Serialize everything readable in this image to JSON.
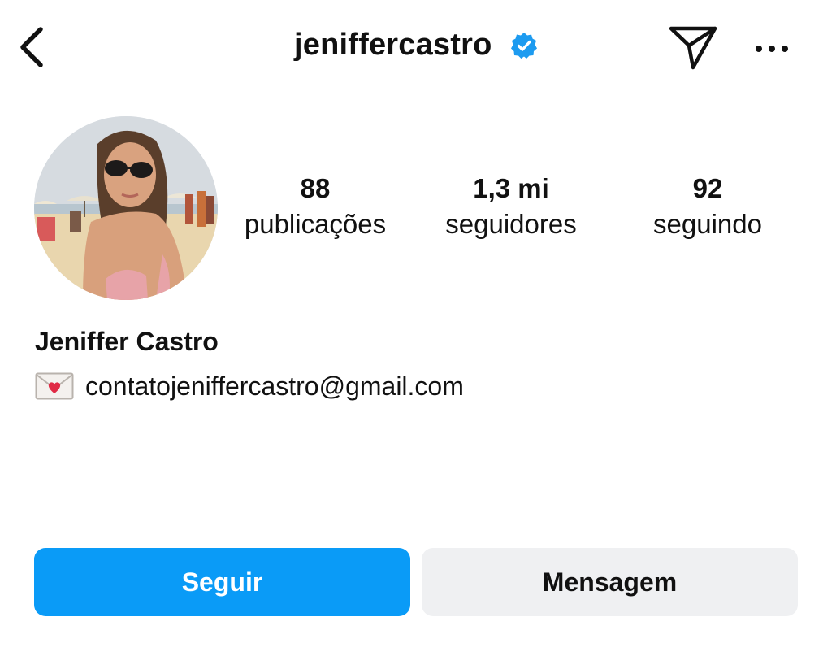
{
  "header": {
    "username": "jeniffercastro",
    "verified_icon": "verified-badge-icon",
    "back_icon": "chevron-left-icon",
    "send_icon": "paper-plane-icon",
    "more_icon": "more-horizontal-icon"
  },
  "profile": {
    "avatar_icon": "profile-photo",
    "stats": {
      "posts": {
        "value": "88",
        "label": "publicações"
      },
      "followers": {
        "value": "1,3 mi",
        "label": "seguidores"
      },
      "following": {
        "value": "92",
        "label": "seguindo"
      }
    },
    "name": "Jeniffer Castro",
    "bio": {
      "icon": "love-letter-icon",
      "email": "contatojeniffercastro@gmail.com"
    }
  },
  "actions": {
    "follow_label": "Seguir",
    "message_label": "Mensagem"
  },
  "colors": {
    "follow_button": "#0a9bf7",
    "message_button": "#eff0f2",
    "verified": "#1d9bf0",
    "text": "#111111"
  }
}
